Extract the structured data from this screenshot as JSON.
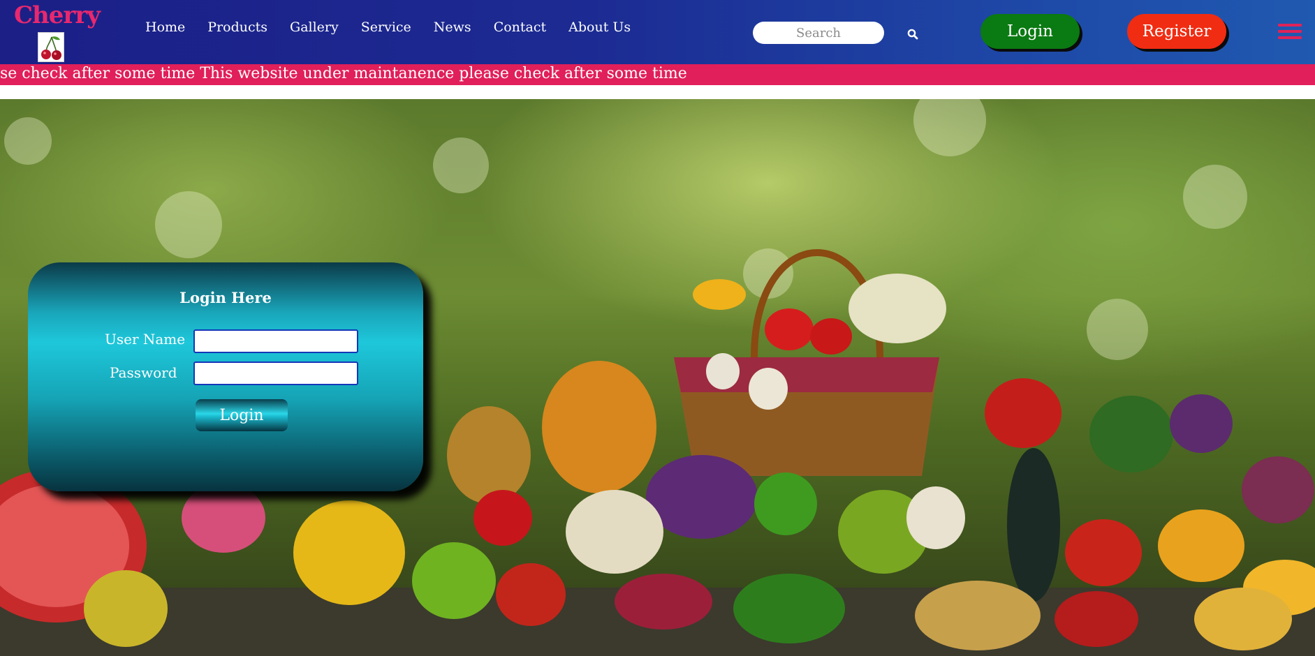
{
  "brand": {
    "name": "Cherry",
    "logo_icon": "cherry-icon"
  },
  "nav": {
    "items": [
      {
        "label": "Home"
      },
      {
        "label": "Products"
      },
      {
        "label": "Gallery"
      },
      {
        "label": "Service"
      },
      {
        "label": "News"
      },
      {
        "label": "Contact"
      },
      {
        "label": "About Us"
      }
    ]
  },
  "search": {
    "placeholder": "Search",
    "icon": "search-icon"
  },
  "header_buttons": {
    "login_label": "Login",
    "register_label": "Register",
    "menu_icon": "hamburger-menu-icon"
  },
  "marquee": {
    "text": "se check after some time This website under maintanence please check after some time"
  },
  "login_form": {
    "title": "Login Here",
    "username_label": "User Name",
    "username_value": "",
    "password_label": "Password",
    "password_value": "",
    "submit_label": "Login"
  },
  "colors": {
    "brand": "#e8286e",
    "header_start": "#1b1f86",
    "header_end": "#2059b0",
    "marquee_bg": "#e11f5a",
    "login_button": "#0a7a12",
    "register_button": "#f02c12",
    "card_accent": "#1ec7da"
  }
}
